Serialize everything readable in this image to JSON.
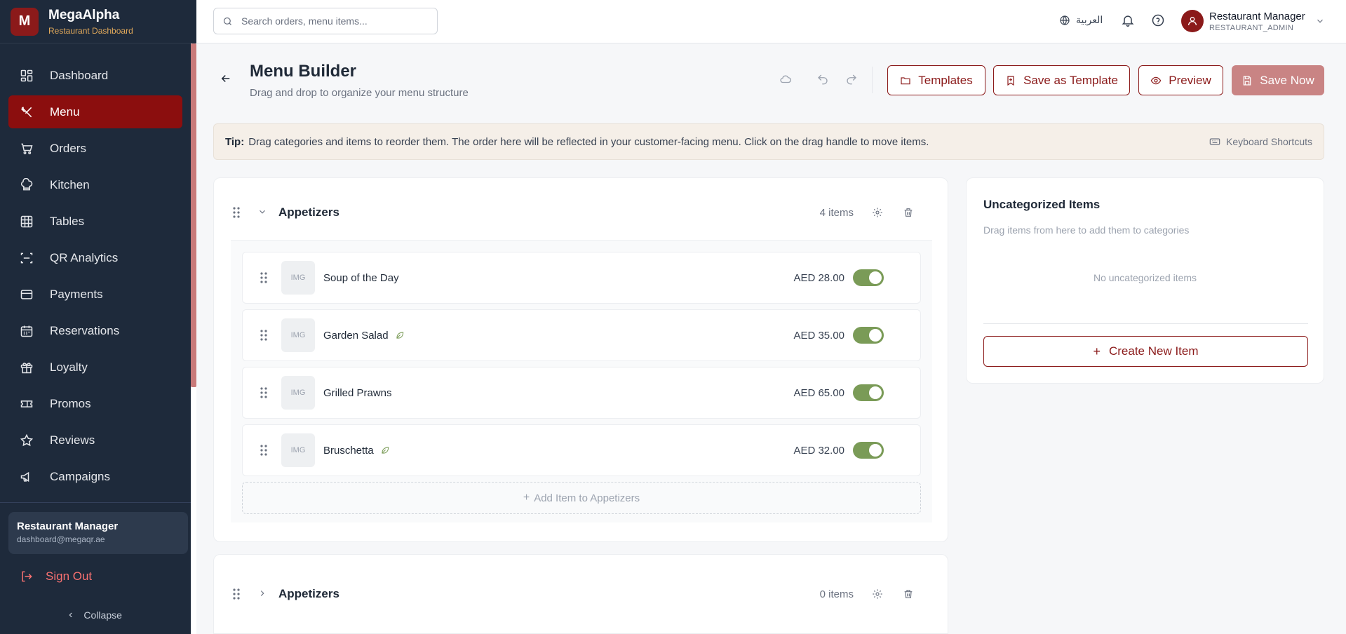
{
  "brand": {
    "logo_letter": "M",
    "name": "MegaAlpha",
    "subtitle": "Restaurant Dashboard"
  },
  "sidebar": {
    "items": [
      {
        "label": "Dashboard",
        "icon": "dashboard-icon",
        "active": false
      },
      {
        "label": "Menu",
        "icon": "utensils-icon",
        "active": true
      },
      {
        "label": "Orders",
        "icon": "cart-icon",
        "active": false
      },
      {
        "label": "Kitchen",
        "icon": "chef-hat-icon",
        "active": false
      },
      {
        "label": "Tables",
        "icon": "grid-icon",
        "active": false
      },
      {
        "label": "QR Analytics",
        "icon": "qr-scan-icon",
        "active": false
      },
      {
        "label": "Payments",
        "icon": "credit-card-icon",
        "active": false
      },
      {
        "label": "Reservations",
        "icon": "calendar-icon",
        "active": false
      },
      {
        "label": "Loyalty",
        "icon": "gift-icon",
        "active": false
      },
      {
        "label": "Promos",
        "icon": "ticket-icon",
        "active": false
      },
      {
        "label": "Reviews",
        "icon": "star-icon",
        "active": false
      },
      {
        "label": "Campaigns",
        "icon": "megaphone-icon",
        "active": false
      }
    ],
    "user": {
      "name": "Restaurant Manager",
      "email": "dashboard@megaqr.ae"
    },
    "sign_out": "Sign Out",
    "collapse": "Collapse"
  },
  "topbar": {
    "search_placeholder": "Search orders, menu items...",
    "language": "العربية",
    "profile": {
      "name": "Restaurant Manager",
      "role": "RESTAURANT_ADMIN"
    }
  },
  "header": {
    "title": "Menu Builder",
    "subtitle": "Drag and drop to organize your menu structure",
    "buttons": {
      "templates": "Templates",
      "save_template": "Save as Template",
      "preview": "Preview",
      "save_now": "Save Now"
    }
  },
  "tip": {
    "label": "Tip:",
    "text": "Drag categories and items to reorder them. The order here will be reflected in your customer-facing menu. Click on the drag handle to move items.",
    "shortcuts": "Keyboard Shortcuts"
  },
  "categories": [
    {
      "name": "Appetizers",
      "count": "4 items",
      "expanded": true,
      "add_label": "Add Item to Appetizers",
      "items": [
        {
          "img": "IMG",
          "name": "Soup of the Day",
          "price": "AED 28.00",
          "vegetarian": false,
          "enabled": true
        },
        {
          "img": "IMG",
          "name": "Garden Salad",
          "price": "AED 35.00",
          "vegetarian": true,
          "enabled": true
        },
        {
          "img": "IMG",
          "name": "Grilled Prawns",
          "price": "AED 65.00",
          "vegetarian": false,
          "enabled": true
        },
        {
          "img": "IMG",
          "name": "Bruschetta",
          "price": "AED 32.00",
          "vegetarian": true,
          "enabled": true
        }
      ]
    },
    {
      "name": "Appetizers",
      "count": "0 items",
      "expanded": false
    }
  ],
  "uncategorized": {
    "title": "Uncategorized Items",
    "subtitle": "Drag items from here to add them to categories",
    "empty": "No uncategorized items",
    "create": "Create New Item"
  },
  "colors": {
    "brand": "#8b1a1a",
    "sidebar_bg": "#1e2a3b",
    "toggle_on": "#7a9b57",
    "tip_bg": "#f5efe8"
  }
}
